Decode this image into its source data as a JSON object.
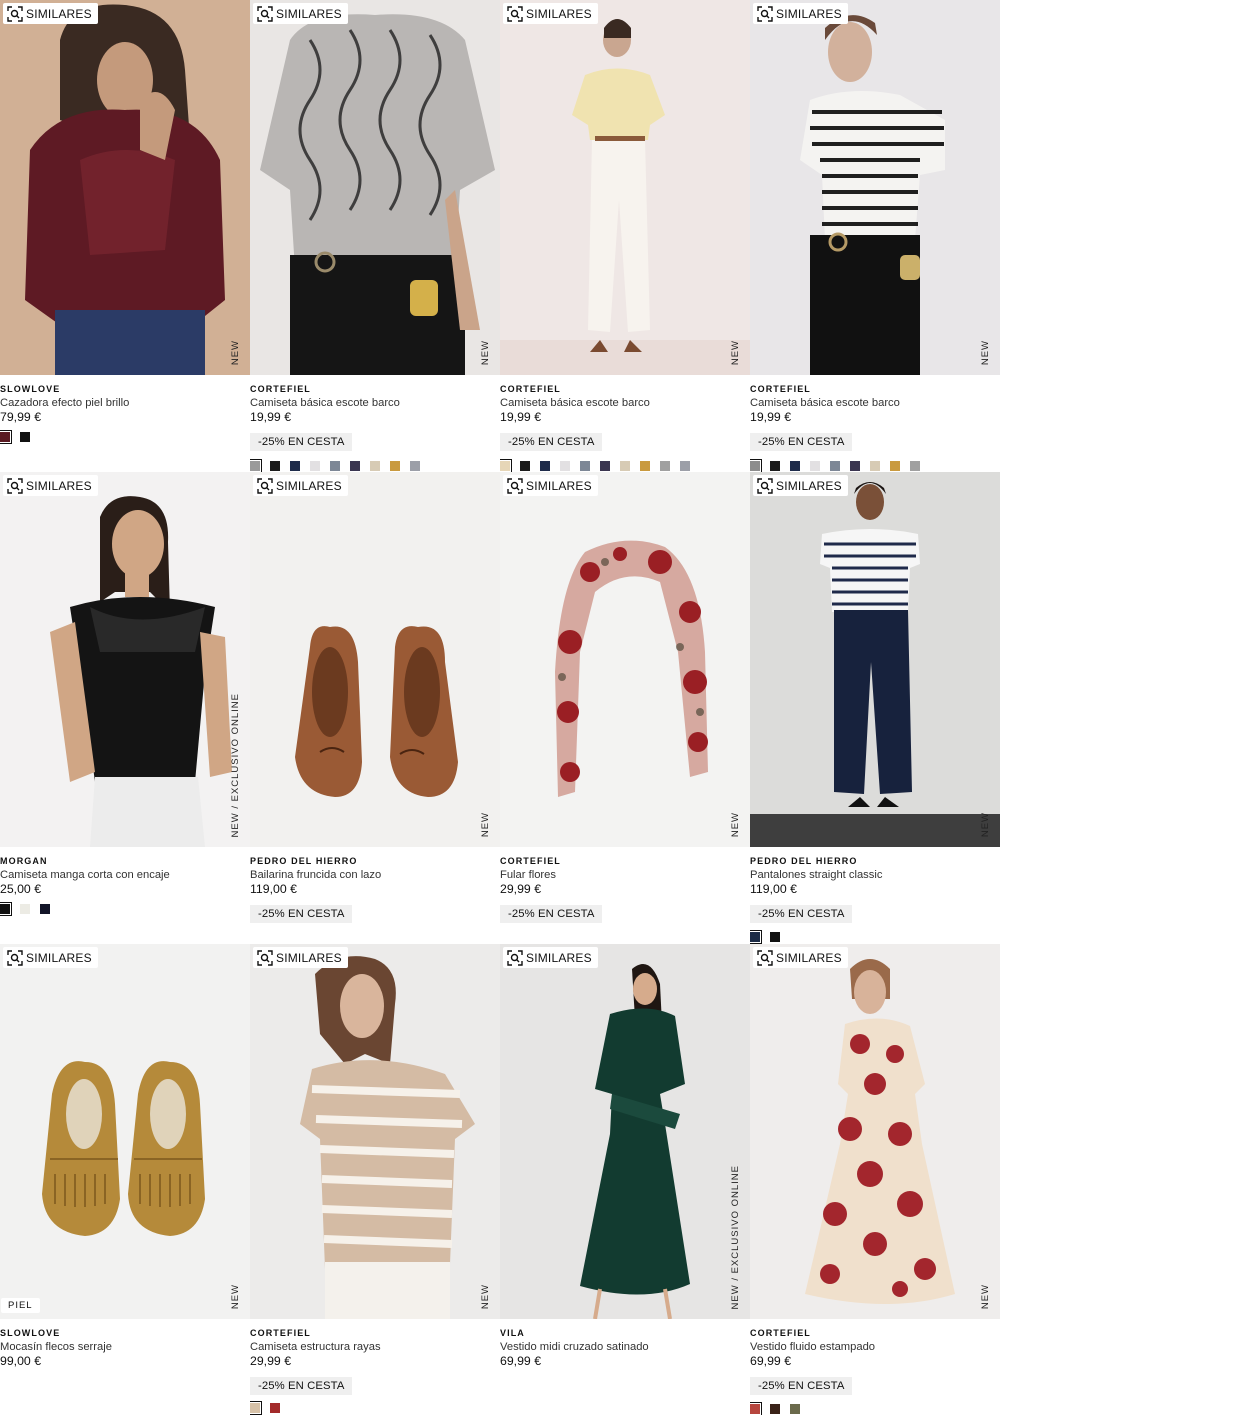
{
  "similares_label": "SIMILARES",
  "products": [
    {
      "brand": "SLOWLOVE",
      "name": "Cazadora efecto piel brillo",
      "price": "79,99 €",
      "promo": "",
      "tag": "NEW",
      "badge": "",
      "swatches": [
        "#5a1a22",
        "#111111"
      ]
    },
    {
      "brand": "CORTEFIEL",
      "name": "Camiseta básica escote barco",
      "price": "19,99 €",
      "promo": "-25% EN CESTA",
      "tag": "NEW",
      "badge": "",
      "swatches": [
        "#9a9a9a",
        "#1b1b1b",
        "#1e2b4a",
        "#e2e0e2",
        "#7d8796",
        "#3a3550",
        "#d7cbb5",
        "#c99a3f",
        "#9c9fa8"
      ]
    },
    {
      "brand": "CORTEFIEL",
      "name": "Camiseta básica escote barco",
      "price": "19,99 €",
      "promo": "-25% EN CESTA",
      "tag": "NEW",
      "badge": "",
      "swatches": [
        "#e6d6b7",
        "#1b1b1b",
        "#1e2b4a",
        "#e2e0e2",
        "#7d8796",
        "#3a3550",
        "#d7cbb5",
        "#c99a3f",
        "#a0a0a0",
        "#9c9fa8"
      ]
    },
    {
      "brand": "CORTEFIEL",
      "name": "Camiseta básica escote barco",
      "price": "19,99 €",
      "promo": "-25% EN CESTA",
      "tag": "NEW",
      "badge": "",
      "swatches": [
        "#8d8d8d",
        "#1b1b1b",
        "#1e2b4a",
        "#e2e0e2",
        "#7d8796",
        "#3a3550",
        "#d7cbb5",
        "#c99a3f",
        "#a0a0a0"
      ]
    },
    {
      "brand": "MORGAN",
      "name": "Camiseta manga corta con encaje",
      "price": "25,00 €",
      "promo": "",
      "tag": "NEW  /  EXCLUSIVO ONLINE",
      "badge": "",
      "swatches": [
        "#111111",
        "#ecebe4",
        "#121528"
      ]
    },
    {
      "brand": "PEDRO DEL HIERRO",
      "name": "Bailarina fruncida con lazo",
      "price": "119,00 €",
      "promo": "-25% EN CESTA",
      "tag": "NEW",
      "badge": "",
      "swatches": []
    },
    {
      "brand": "CORTEFIEL",
      "name": "Fular flores",
      "price": "29,99 €",
      "promo": "-25% EN CESTA",
      "tag": "NEW",
      "badge": "",
      "swatches": []
    },
    {
      "brand": "PEDRO DEL HIERRO",
      "name": "Pantalones straight classic",
      "price": "119,00 €",
      "promo": "-25% EN CESTA",
      "tag": "NEW",
      "badge": "",
      "swatches": [
        "#1c2b46",
        "#111111"
      ]
    },
    {
      "brand": "SLOWLOVE",
      "name": "Mocasín flecos serraje",
      "price": "99,00 €",
      "promo": "",
      "tag": "NEW",
      "badge": "PIEL",
      "swatches": []
    },
    {
      "brand": "CORTEFIEL",
      "name": "Camiseta estructura rayas",
      "price": "29,99 €",
      "promo": "-25% EN CESTA",
      "tag": "NEW",
      "badge": "",
      "swatches": [
        "#d7c2a8",
        "#a32a2a"
      ]
    },
    {
      "brand": "VILA",
      "name": "Vestido midi cruzado satinado",
      "price": "69,99 €",
      "promo": "",
      "tag": "NEW  /  EXCLUSIVO ONLINE",
      "badge": "",
      "swatches": []
    },
    {
      "brand": "CORTEFIEL",
      "name": "Vestido fluido estampado",
      "price": "69,99 €",
      "promo": "-25% EN CESTA",
      "tag": "NEW",
      "badge": "",
      "swatches": [
        "#b7463e",
        "#3a2218",
        "#6b6a4c"
      ]
    }
  ]
}
